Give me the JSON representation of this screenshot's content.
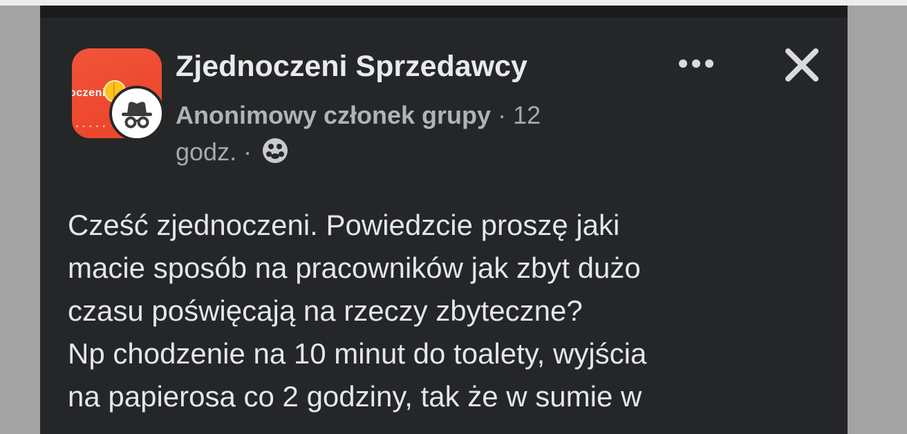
{
  "group": {
    "name": "Zjednoczeni Sprzedawcy",
    "avatar_text": "oczeni",
    "avatar_icon": "orange-fruit-logo"
  },
  "author": {
    "name": "Anonimowy członek grupy",
    "avatar_icon": "anonymous-incognito-icon"
  },
  "meta": {
    "separator": "·",
    "time_part1": "12",
    "time_part2": "godz.",
    "privacy_icon": "group-members-icon"
  },
  "actions": {
    "more_icon": "more-options-icon",
    "close_icon": "close-icon"
  },
  "post": {
    "lines": [
      "Cześć zjednoczeni. Powiedzcie proszę jaki",
      "macie sposób na pracowników jak zbyt dużo",
      "czasu poświęcają na rzeczy zbyteczne?",
      "Np chodzenie na 10 minut do toalety, wyjścia",
      "na papierosa co 2 godziny, tak że w sumie w"
    ]
  },
  "colors": {
    "panel_background": "#252628",
    "primary_text": "#e4e6eb",
    "secondary_text": "#b0b3b8",
    "group_avatar": "#ee4a2f"
  }
}
